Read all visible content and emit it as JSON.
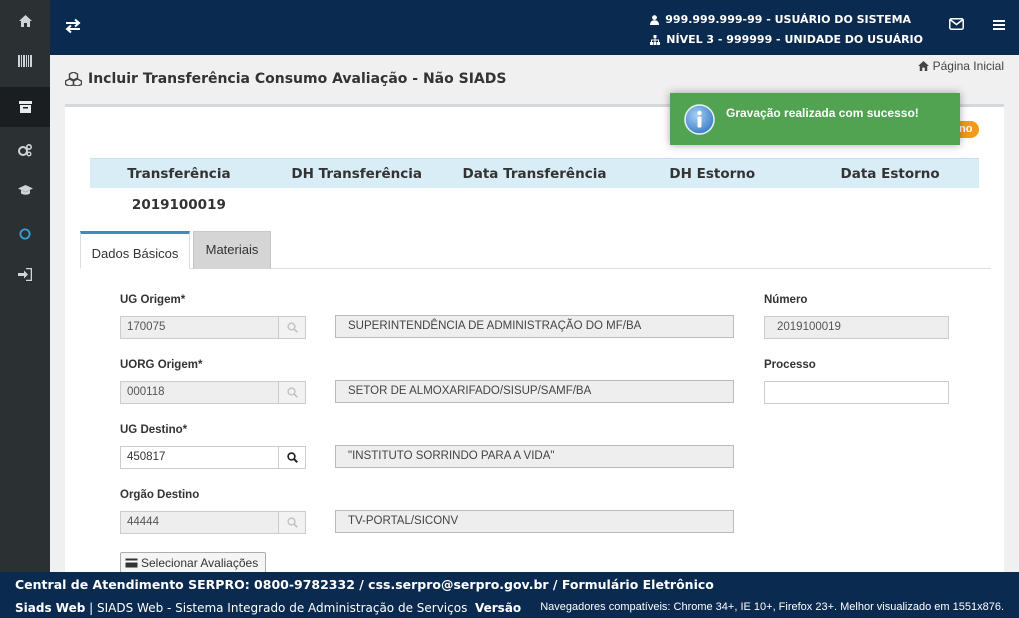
{
  "header": {
    "user_line": "999.999.999-99 - USUÁRIO DO SISTEMA",
    "level_line": "NÍVEL 3 - 999999 - UNIDADE DO USUÁRIO"
  },
  "page": {
    "title": "Incluir Transferência Consumo Avaliação - Não SIADS",
    "home_link": "Página Inicial"
  },
  "badge": "no",
  "toast": {
    "message": "Gravação realizada com sucesso!"
  },
  "summary": {
    "headers": [
      "Transferência",
      "DH Transferência",
      "Data Transferência",
      "DH Estorno",
      "Data Estorno"
    ],
    "values": [
      "2019100019",
      "",
      "",
      "",
      ""
    ]
  },
  "tabs": [
    {
      "label": "Dados Básicos",
      "active": true
    },
    {
      "label": "Materiais",
      "active": false
    }
  ],
  "form": {
    "ug_origem": {
      "label": "UG Origem*",
      "code": "170075",
      "description": "SUPERINTENDÊNCIA DE ADMINISTRAÇÃO DO MF/BA"
    },
    "uorg_origem": {
      "label": "UORG Origem*",
      "code": "000118",
      "description": "SETOR DE ALMOXARIFADO/SISUP/SAMF/BA"
    },
    "ug_destino": {
      "label": "UG Destino*",
      "code": "450817",
      "description": "\"INSTITUTO SORRINDO PARA A VIDA\""
    },
    "orgao_destino": {
      "label": "Orgão Destino",
      "code": "44444",
      "description": "TV-PORTAL/SICONV"
    },
    "numero": {
      "label": "Número",
      "value": "2019100019"
    },
    "processo": {
      "label": "Processo",
      "value": ""
    },
    "select_button": "Selecionar Avaliações"
  },
  "footer": {
    "line1": "Central de Atendimento SERPRO: 0800-9782332 / css.serpro@serpro.gov.br / Formulário Eletrônico",
    "app_name": "Siads Web",
    "app_desc": "| SIADS Web - Sistema Integrado de Administração de Serviços",
    "version_label": "Versão",
    "browsers": "Navegadores compatíveis: Chrome 34+, IE 10+, Firefox 23+. Melhor visualizado em 1551x876."
  },
  "colors": {
    "header_bg": "#0b2a4f",
    "sidebar_bg": "#2b3033",
    "toast_bg": "#51a351",
    "table_head_bg": "#d9edf7",
    "tab_accent": "#3c8dbc",
    "badge": "#f39c12"
  }
}
